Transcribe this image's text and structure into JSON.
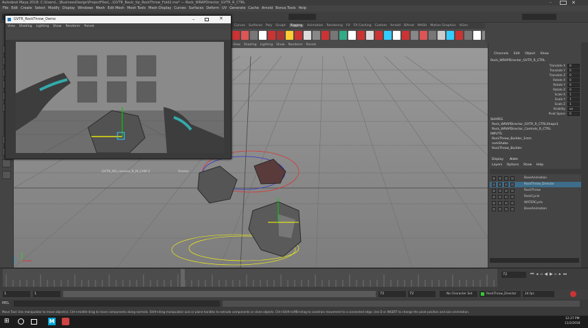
{
  "window": {
    "title": "Autodesk Maya 2018: C:\\Users\\...\\BusinessDesign\\ProjectFiles\\...\\GVTR_Basic_tip_RockThrow_Fold2.ma* --- Rock_WRAPDirector_GVTR_R_CTRL"
  },
  "menubar": [
    "File",
    "Edit",
    "Create",
    "Select",
    "Modify",
    "Display",
    "Windows",
    "Mesh",
    "Edit Mesh",
    "Mesh Tools",
    "Mesh Display",
    "Curves",
    "Surfaces",
    "Deform",
    "UV",
    "Generate",
    "Cache",
    "Arnold",
    "Bonus Tools",
    "Help"
  ],
  "shelf": {
    "tabs": [
      "Curves",
      "Surfaces",
      "Poly",
      "Sculpt",
      "Rigging",
      "Animation",
      "Rendering",
      "FX",
      "FX Caching",
      "Custom",
      "Arnold",
      "Bifrost",
      "MASH",
      "Motion Graphics",
      "XGen"
    ],
    "active_tab": "Rigging"
  },
  "float_window": {
    "title": "GVTR_RockThrow_Demo",
    "menu": [
      "View",
      "Shading",
      "Lighting",
      "Show",
      "Renderer",
      "Panels"
    ],
    "caption": "GVTR_RD_camera_R_M_CAM 2",
    "frame_label": "Frame:"
  },
  "panel_menu": [
    "View",
    "Shading",
    "Lighting",
    "Show",
    "Renderer",
    "Panels"
  ],
  "channel_box": {
    "tabs": [
      "Channels",
      "Edit",
      "Object",
      "Show"
    ],
    "object": "Rock_WRAPDirector_GVTR_R_CTRL",
    "attributes": [
      {
        "label": "Translate X",
        "value": "0"
      },
      {
        "label": "Translate Y",
        "value": "0"
      },
      {
        "label": "Translate Z",
        "value": "0"
      },
      {
        "label": "Rotate X",
        "value": "0"
      },
      {
        "label": "Rotate Y",
        "value": "0"
      },
      {
        "label": "Rotate Z",
        "value": "0"
      },
      {
        "label": "Scale X",
        "value": "1"
      },
      {
        "label": "Scale Y",
        "value": "1"
      },
      {
        "label": "Scale Z",
        "value": "1"
      },
      {
        "label": "Visibility",
        "value": "on"
      },
      {
        "label": "Pivot Space",
        "value": "0"
      }
    ],
    "shapes_header": "SHAPES",
    "shapes": [
      "Rock_WRAPDirector_GVTR_R_CTRLShape1",
      "Rock_WRAPDirector_Controls_R_CTRL"
    ],
    "inputs_header": "INPUTS",
    "inputs": [
      "RockThrow_Builder_1mm",
      "rockShake",
      "RockThrow_Builder"
    ]
  },
  "layer_editor": {
    "tabs": [
      "Display",
      "Anim"
    ],
    "menu": [
      "Layers",
      "Options",
      "Show",
      "Help"
    ],
    "layers": [
      "BaseAnimation",
      "RockThrow_Director",
      "RockThrow",
      "RockCycle",
      "WATERCycle",
      "BaseAnimation"
    ]
  },
  "time_slider": {
    "start": "1",
    "end": "72",
    "range_start": "1",
    "range_end": "72",
    "anim_start": "72",
    "current_frame": "50",
    "character_set": "No Character Set",
    "anim_layer": "RockThrow_Director",
    "fps": "24 fps"
  },
  "mel_label": "MEL",
  "help_line": "Move Tool: Use manipulator to move object(s). Ctrl+middle-drag to move components along normals. Shift+drag manipulator axis or plane handles to extrude components or clone objects. Ctrl+Shift+LMB+drag to constrain movement to a connected edge. Use D or INSERT to change the pivot position and axis orientation.",
  "clock": {
    "time": "12:27 PM",
    "date": "11/2/2018"
  },
  "colors": {
    "accent": "#5285a6",
    "maya_blue": "#00a5d6",
    "selected_layer": "#3d6d8a"
  }
}
